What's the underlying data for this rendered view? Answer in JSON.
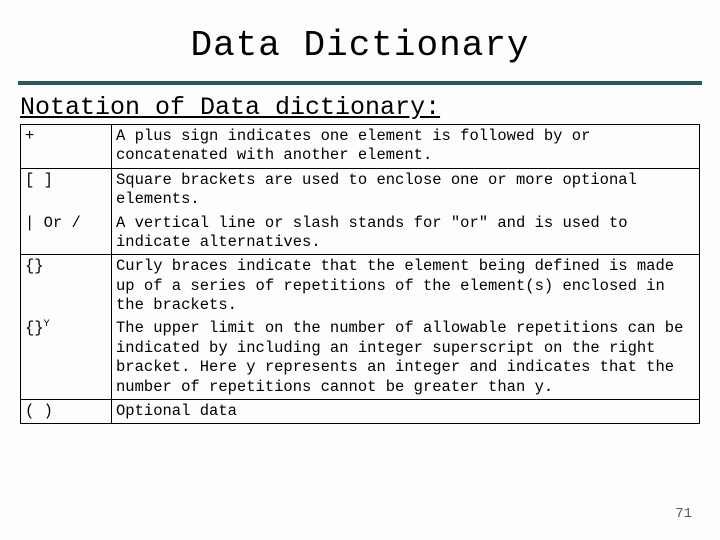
{
  "title": "Data Dictionary",
  "subtitle": "Notation of Data dictionary:",
  "rows": {
    "r0": {
      "sym": "+",
      "desc": " A plus sign indicates one element is followed by or concatenated with another element."
    },
    "r1": {
      "sym": "[ ]",
      "desc": "Square brackets are used to enclose one or more optional elements."
    },
    "r2": {
      "sym": "| Or /",
      "desc": "A vertical line or slash stands for \"or\" and is used to indicate alternatives."
    },
    "r3": {
      "sym": "{}",
      "desc": "Curly braces indicate that the element being defined is made up of a series of repetitions of the element(s) enclosed in the brackets."
    },
    "r4": {
      "sym_base": "{}",
      "sym_sup": "Y",
      "desc": "The upper limit on the number of allowable repetitions can be indicated by including an integer superscript on the right bracket. Here y represents an integer and indicates that the number of repetitions cannot be greater than y."
    },
    "r5": {
      "sym": "( )",
      "desc": "Optional data"
    }
  },
  "page_number": "71"
}
